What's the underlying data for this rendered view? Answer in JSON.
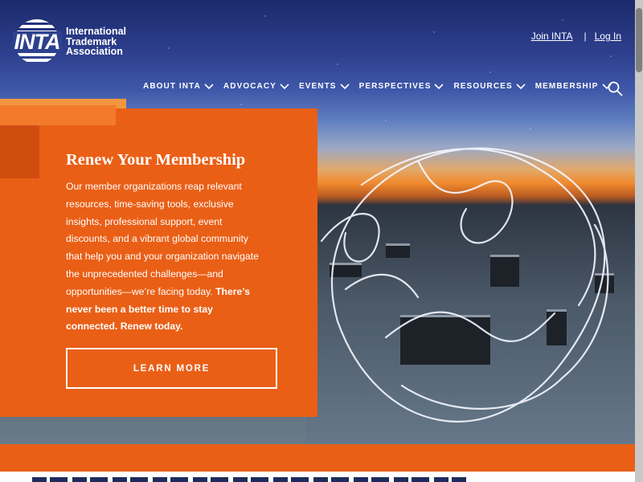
{
  "header": {
    "logo_mark": "INTA",
    "org_name": "International Trademark Association",
    "top_links": {
      "join": "Join INTA",
      "separator": "|",
      "login": "Log In"
    }
  },
  "nav": {
    "items": [
      {
        "label": "ABOUT INTA"
      },
      {
        "label": "ADVOCACY"
      },
      {
        "label": "EVENTS"
      },
      {
        "label": "PERSPECTIVES"
      },
      {
        "label": "RESOURCES"
      },
      {
        "label": "MEMBERSHIP"
      }
    ],
    "search_icon": "search-icon"
  },
  "promo": {
    "title": "Renew Your Membership",
    "body": "Our member organizations reap relevant resources, time-saving tools, exclusive insights, professional support, event discounts, and a vibrant global community that help you and your organization navigate the unprecedented challenges—and opportunities—we’re facing today.",
    "body_bold": "There’s never been a better time to stay connected. Renew today.",
    "cta": "LEARN MORE"
  },
  "colors": {
    "brand_orange": "#ea5f16",
    "navy": "#2d418e"
  }
}
